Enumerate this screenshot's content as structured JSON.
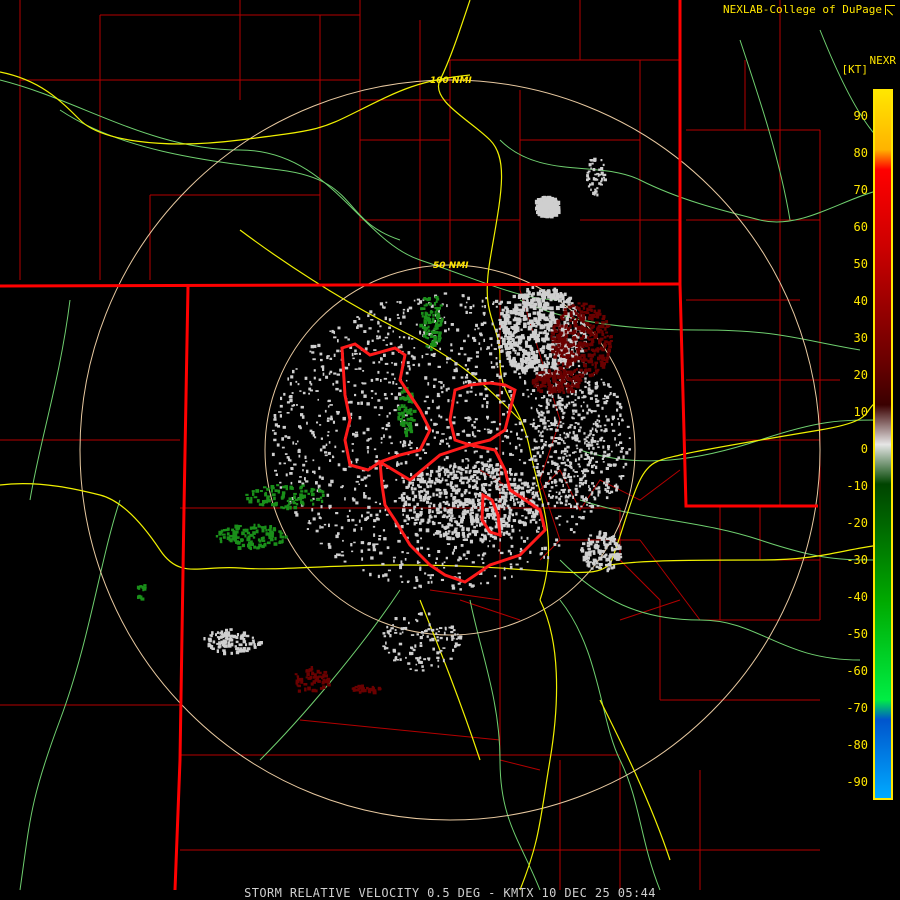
{
  "credit": "NEXLAB-College of DuPage",
  "credit_icon": "external-link-icon",
  "legend": {
    "product": "NEXR",
    "unit": "[KT]",
    "ticks": [
      "90",
      "80",
      "70",
      "60",
      "50",
      "40",
      "30",
      "20",
      "10",
      "0",
      "-10",
      "-20",
      "-30",
      "-40",
      "-50",
      "-60",
      "-70",
      "-80",
      "-90"
    ],
    "colors": [
      {
        "value": 90,
        "color": "#ffe600"
      },
      {
        "value": 75,
        "color": "#ffb300"
      },
      {
        "value": 70,
        "color": "#ff0000"
      },
      {
        "value": 50,
        "color": "#cc0000"
      },
      {
        "value": 20,
        "color": "#660000"
      },
      {
        "value": 10,
        "color": "#3a0000"
      },
      {
        "value": 0,
        "color": "#e6e6e6"
      },
      {
        "value": -10,
        "color": "#004400"
      },
      {
        "value": -40,
        "color": "#00aa00"
      },
      {
        "value": -65,
        "color": "#00ee44"
      },
      {
        "value": -70,
        "color": "#0055cc"
      },
      {
        "value": -90,
        "color": "#00aaff"
      }
    ]
  },
  "rings": {
    "inner_label": "50 NMI",
    "outer_label": "100 NMI"
  },
  "footer": "STORM RELATIVE VELOCITY 0.5 DEG - KMTX 10 DEC 25 05:44",
  "colors": {
    "state_border": "#ff0000",
    "county_border": "#bb0000",
    "highway": "#f0f000",
    "roads": "#7fd07f",
    "warning_polygon": "#ff1a1a",
    "range_ring": "#e8c9a0",
    "echo_zero": "#cfcfcf",
    "echo_inbound": "#1a8f1a",
    "echo_outbound": "#6a0000"
  }
}
